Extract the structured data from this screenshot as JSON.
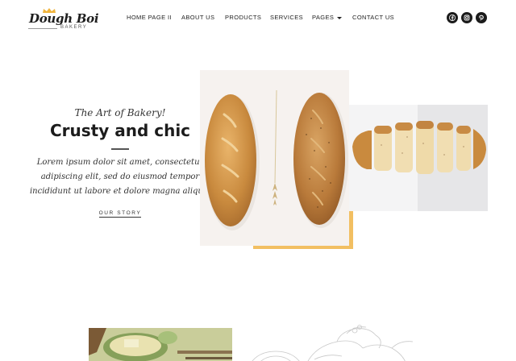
{
  "brand": {
    "name": "Dough Boi",
    "tagline": "BAKERY"
  },
  "nav": {
    "items": [
      {
        "label": "HOME PAGE II"
      },
      {
        "label": "ABOUT US"
      },
      {
        "label": "PRODUCTS"
      },
      {
        "label": "SERVICES"
      },
      {
        "label": "PAGES"
      },
      {
        "label": "CONTACT US"
      }
    ]
  },
  "social": [
    "facebook-icon",
    "instagram-icon",
    "pinterest-icon"
  ],
  "hero": {
    "tagline": "The Art of Bakery!",
    "headline": "Crusty and chic",
    "body": "Lorem ipsum dolor sit amet, consectetur adipiscing elit, sed do eiusmod tempor incididunt ut labore et dolore magna aliqua.",
    "cta": "OUR STORY"
  },
  "colors": {
    "accent": "#f2bf62",
    "text": "#222222",
    "icon_bg": "#1b1b1b"
  }
}
